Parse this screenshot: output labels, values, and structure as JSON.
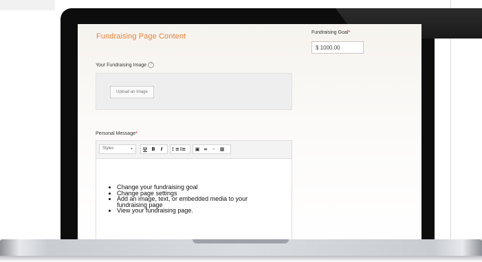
{
  "form": {
    "section_title": "Fundraising Page Content",
    "goal_label": "Fundraising Goal",
    "goal_value": "$  1000.00",
    "required_marker": "*",
    "image_label": "Your Fundraising Image",
    "info_icon_glyph": "?",
    "upload_button": "Upload an Image",
    "message_label": "Personal Message"
  },
  "editor": {
    "styles_dropdown": "Styles",
    "dropdown_arrow": "▾",
    "toolbar": {
      "underline": "U",
      "bold": "B",
      "italic": "I",
      "ordered_list": "⋮≡",
      "bullet_list": "⁝≡",
      "image": "▣",
      "link": "∞",
      "unlink": "⚭",
      "media": "▦"
    },
    "bullets": [
      "Change your fundraising goal",
      "Change page settings",
      "Add an image, text, or embedded media to your fundraising page",
      "View your fundraising page."
    ]
  },
  "colors": {
    "title_orange": "#e8833a",
    "required_red": "#d0021b",
    "bezel": "#0d0d0d"
  },
  "icons": [
    "info-icon",
    "underline-icon",
    "bold-icon",
    "italic-icon",
    "ordered-list-icon",
    "bullet-list-icon",
    "image-icon",
    "link-icon",
    "unlink-icon",
    "media-icon"
  ]
}
